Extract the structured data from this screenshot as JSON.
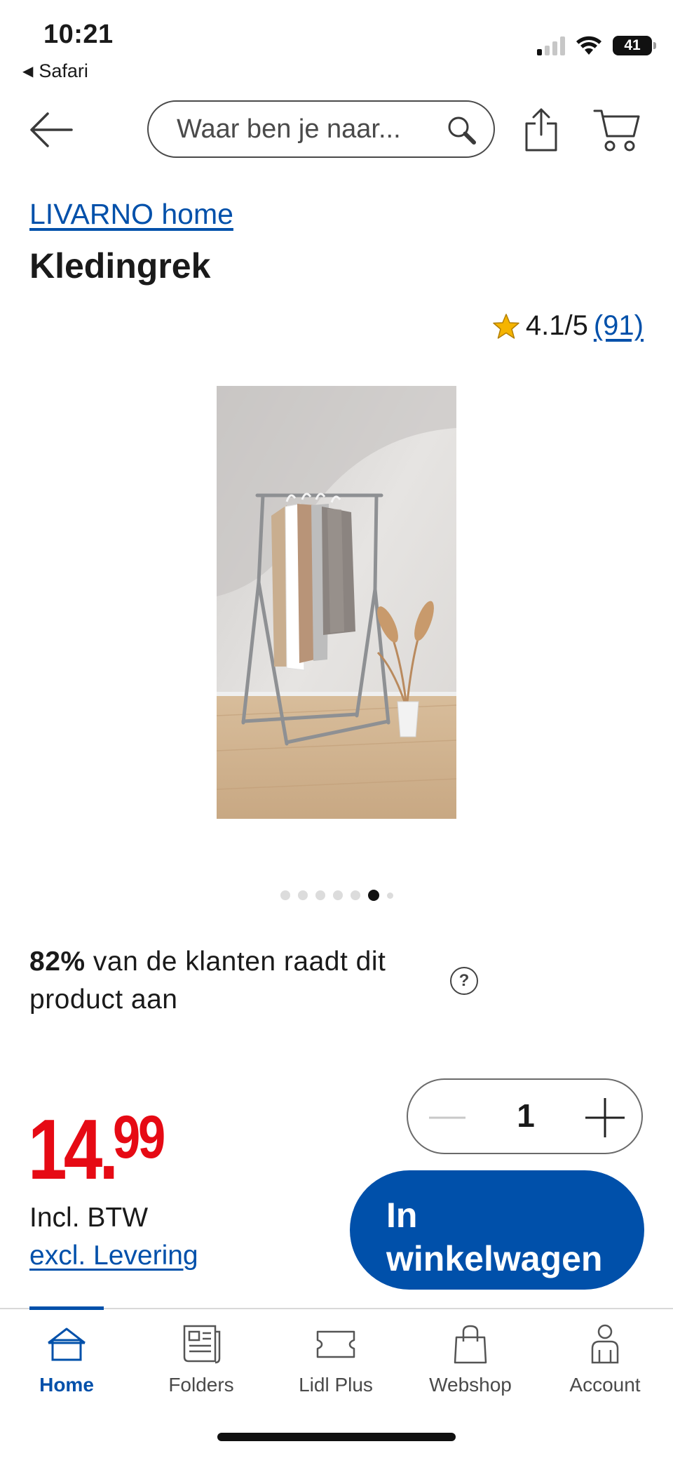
{
  "status_bar": {
    "time": "10:21",
    "back_app": "Safari",
    "battery": "41"
  },
  "header": {
    "search_placeholder": "Waar ben je naar...",
    "icons": [
      "back-arrow-icon",
      "search-icon",
      "share-icon",
      "cart-icon"
    ]
  },
  "product": {
    "brand": "LIVARNO home",
    "title": "Kledingrek",
    "rating": "4.1/5",
    "review_count": "(91)",
    "image_count": 7,
    "active_image_index": 5
  },
  "recommendation": {
    "percent": "82%",
    "text": " van de klanten raadt dit product aan",
    "help_label": "?"
  },
  "purchase": {
    "quantity": "1",
    "price_main": "14",
    "price_sep": ".",
    "price_cents": "99",
    "incl_vat": "Incl. BTW",
    "excl_delivery": "excl. Levering",
    "add_to_cart_line1": "In",
    "add_to_cart_line2": "winkelwagen"
  },
  "tabbar": {
    "items": [
      {
        "label": "Home",
        "icon": "home-icon"
      },
      {
        "label": "Folders",
        "icon": "folder-icon"
      },
      {
        "label": "Lidl Plus",
        "icon": "ticket-icon"
      },
      {
        "label": "Webshop",
        "icon": "shopping-bag-icon"
      },
      {
        "label": "Account",
        "icon": "account-icon"
      }
    ],
    "active": "Home"
  },
  "colors": {
    "brand_blue": "#0050aa",
    "price_red": "#e60a14"
  }
}
